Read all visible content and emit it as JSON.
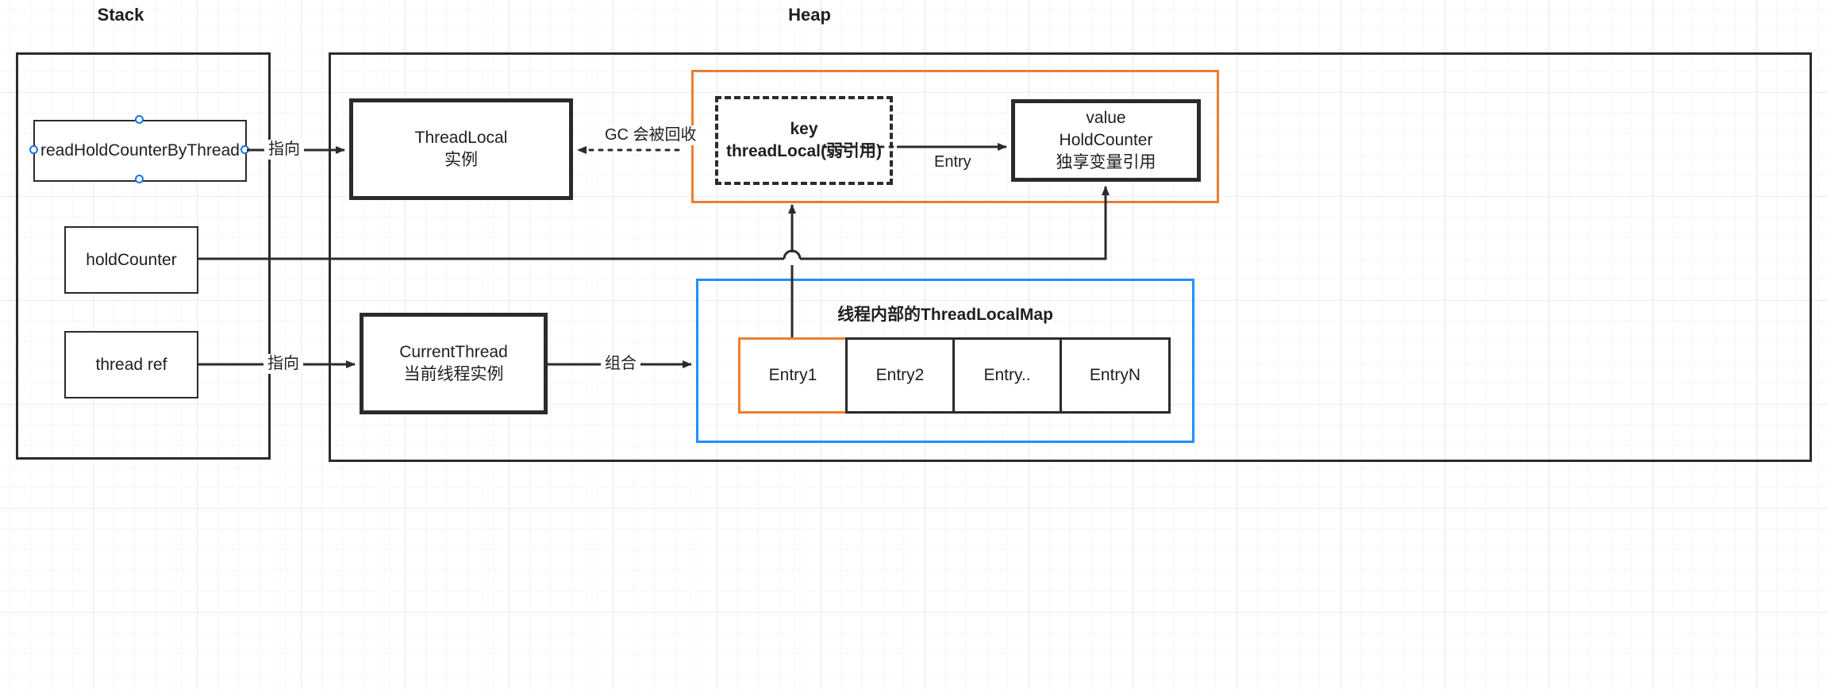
{
  "regions": {
    "stack": {
      "title": "Stack"
    },
    "heap": {
      "title": "Heap"
    }
  },
  "stack_nodes": {
    "read_hold_counter": {
      "label": "readHoldCounterByThread"
    },
    "hold_counter": {
      "label": "holdCounter"
    },
    "thread_ref": {
      "label": "thread ref"
    }
  },
  "heap_nodes": {
    "threadlocal_instance": {
      "label": "ThreadLocal\n实例"
    },
    "current_thread": {
      "label": "CurrentThread\n当前线程实例"
    },
    "entry_key": {
      "label": "key\nthreadLocal(弱引用)"
    },
    "entry_value": {
      "label": "value\nHoldCounter\n独享变量引用"
    }
  },
  "groups": {
    "entry_group": {
      "accent": "#ED7D31"
    },
    "threadlocalmap": {
      "label": "线程内部的ThreadLocalMap",
      "accent": "#1E90FF"
    }
  },
  "entries": [
    {
      "label": "Entry1",
      "highlight": true
    },
    {
      "label": "Entry2",
      "highlight": false
    },
    {
      "label": "Entry..",
      "highlight": false
    },
    {
      "label": "EntryN",
      "highlight": false
    }
  ],
  "edge_labels": {
    "point_to_threadlocal": "指向",
    "point_to_currentthread": "指向",
    "gc_collect": "GC\n会被回收",
    "entry": "Entry",
    "composition": "组合"
  },
  "colors": {
    "stroke": "#2b2b2b",
    "orange": "#ED7D31",
    "blue": "#1E90FF",
    "handle": "#1a73e8",
    "grid": "#ececec"
  }
}
